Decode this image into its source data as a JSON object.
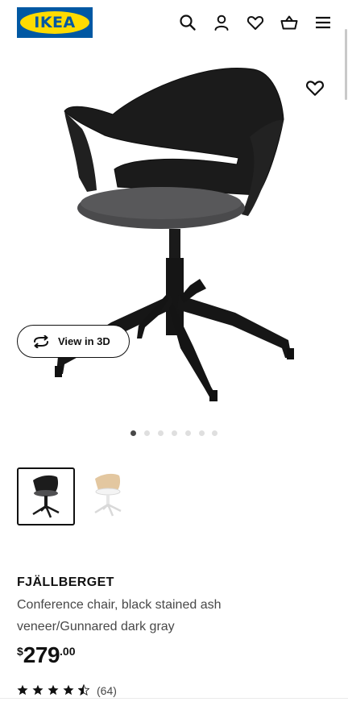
{
  "header": {
    "logo_text": "IKEA",
    "icons": [
      "search-icon",
      "account-icon",
      "heart-icon",
      "basket-icon",
      "menu-icon"
    ]
  },
  "gallery": {
    "view3d_label": "View in 3D",
    "dot_count": 7,
    "active_dot": 0,
    "thumbnails": [
      "black-chair-thumbnail",
      "white-chair-thumbnail"
    ],
    "selected_thumbnail": 0
  },
  "product": {
    "name": "FJÄLLBERGET",
    "description": "Conference chair, black stained ash veneer/Gunnared dark gray",
    "price": {
      "currency": "$",
      "whole": "279",
      "cents": ".00"
    },
    "rating": {
      "stars": 4.5,
      "max": 5,
      "count": "(64)"
    }
  },
  "colors": {
    "brand_blue": "#0058a3",
    "brand_yellow": "#ffdb00",
    "text": "#111111",
    "muted_text": "#484848"
  }
}
